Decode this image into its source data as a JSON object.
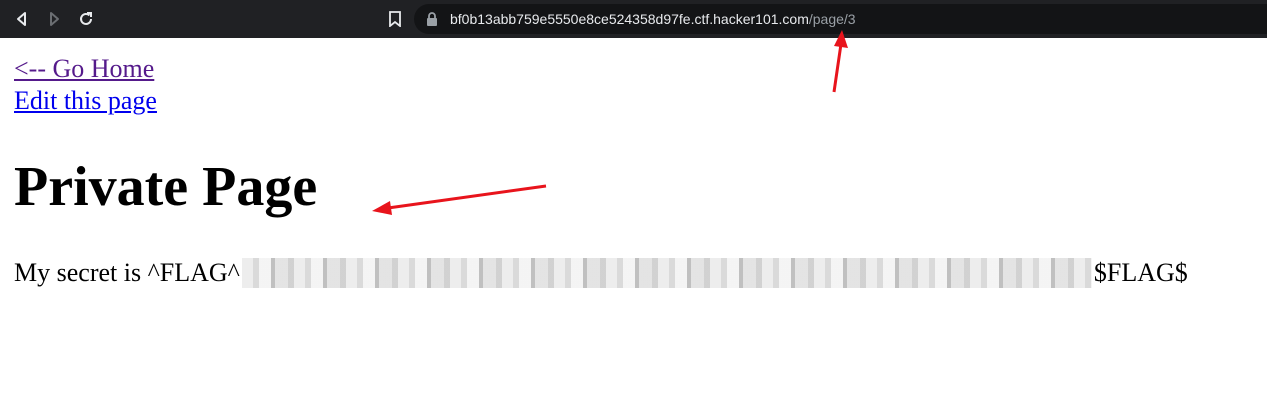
{
  "browser": {
    "url_host": "bf0b13abb759e5550e8ce524358d97fe.ctf.hacker101.com",
    "url_path": "/page/3",
    "back_icon": "back-icon",
    "forward_icon": "forward-icon",
    "reload_icon": "reload-icon",
    "bookmark_icon": "bookmark-icon",
    "lock_icon": "lock-icon"
  },
  "page": {
    "home_link": "<-- Go Home",
    "edit_link": "Edit this page",
    "title": "Private Page",
    "secret_prefix": "My secret is ^FLAG^",
    "secret_suffix": "$FLAG$"
  },
  "annotations": {
    "arrow_color": "#e8141c"
  }
}
